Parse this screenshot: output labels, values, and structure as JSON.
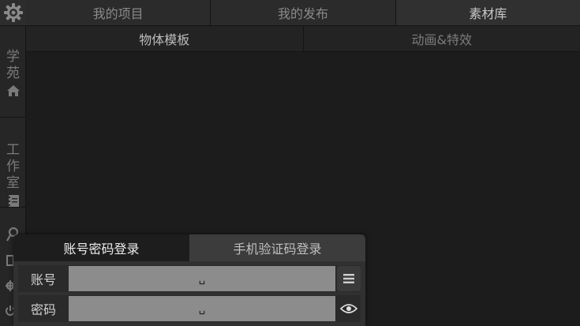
{
  "rail": {
    "gear_icon": "gear-icon",
    "academy": {
      "chars": [
        "学",
        "苑"
      ],
      "icon": "home-icon"
    },
    "studio": {
      "chars": [
        "工",
        "作",
        "室"
      ],
      "icon": "notebook-icon"
    },
    "bottom_icons": [
      "user-icon",
      "square-icon",
      "settings-icon",
      "power-icon"
    ]
  },
  "top_tabs": [
    {
      "label": "我的项目",
      "active": false
    },
    {
      "label": "我的发布",
      "active": false
    },
    {
      "label": "素材库",
      "active": true
    }
  ],
  "sub_tabs": [
    {
      "label": "物体模板",
      "active": true
    },
    {
      "label": "动画&特效",
      "active": false
    }
  ],
  "login": {
    "tabs": [
      {
        "label": "账号密码登录",
        "active": true
      },
      {
        "label": "手机验证码登录",
        "active": false
      }
    ],
    "account": {
      "label": "账号",
      "value": "␣",
      "button_icon": "menu-icon"
    },
    "password": {
      "label": "密码",
      "value": "␣",
      "button_icon": "eye-icon"
    }
  }
}
